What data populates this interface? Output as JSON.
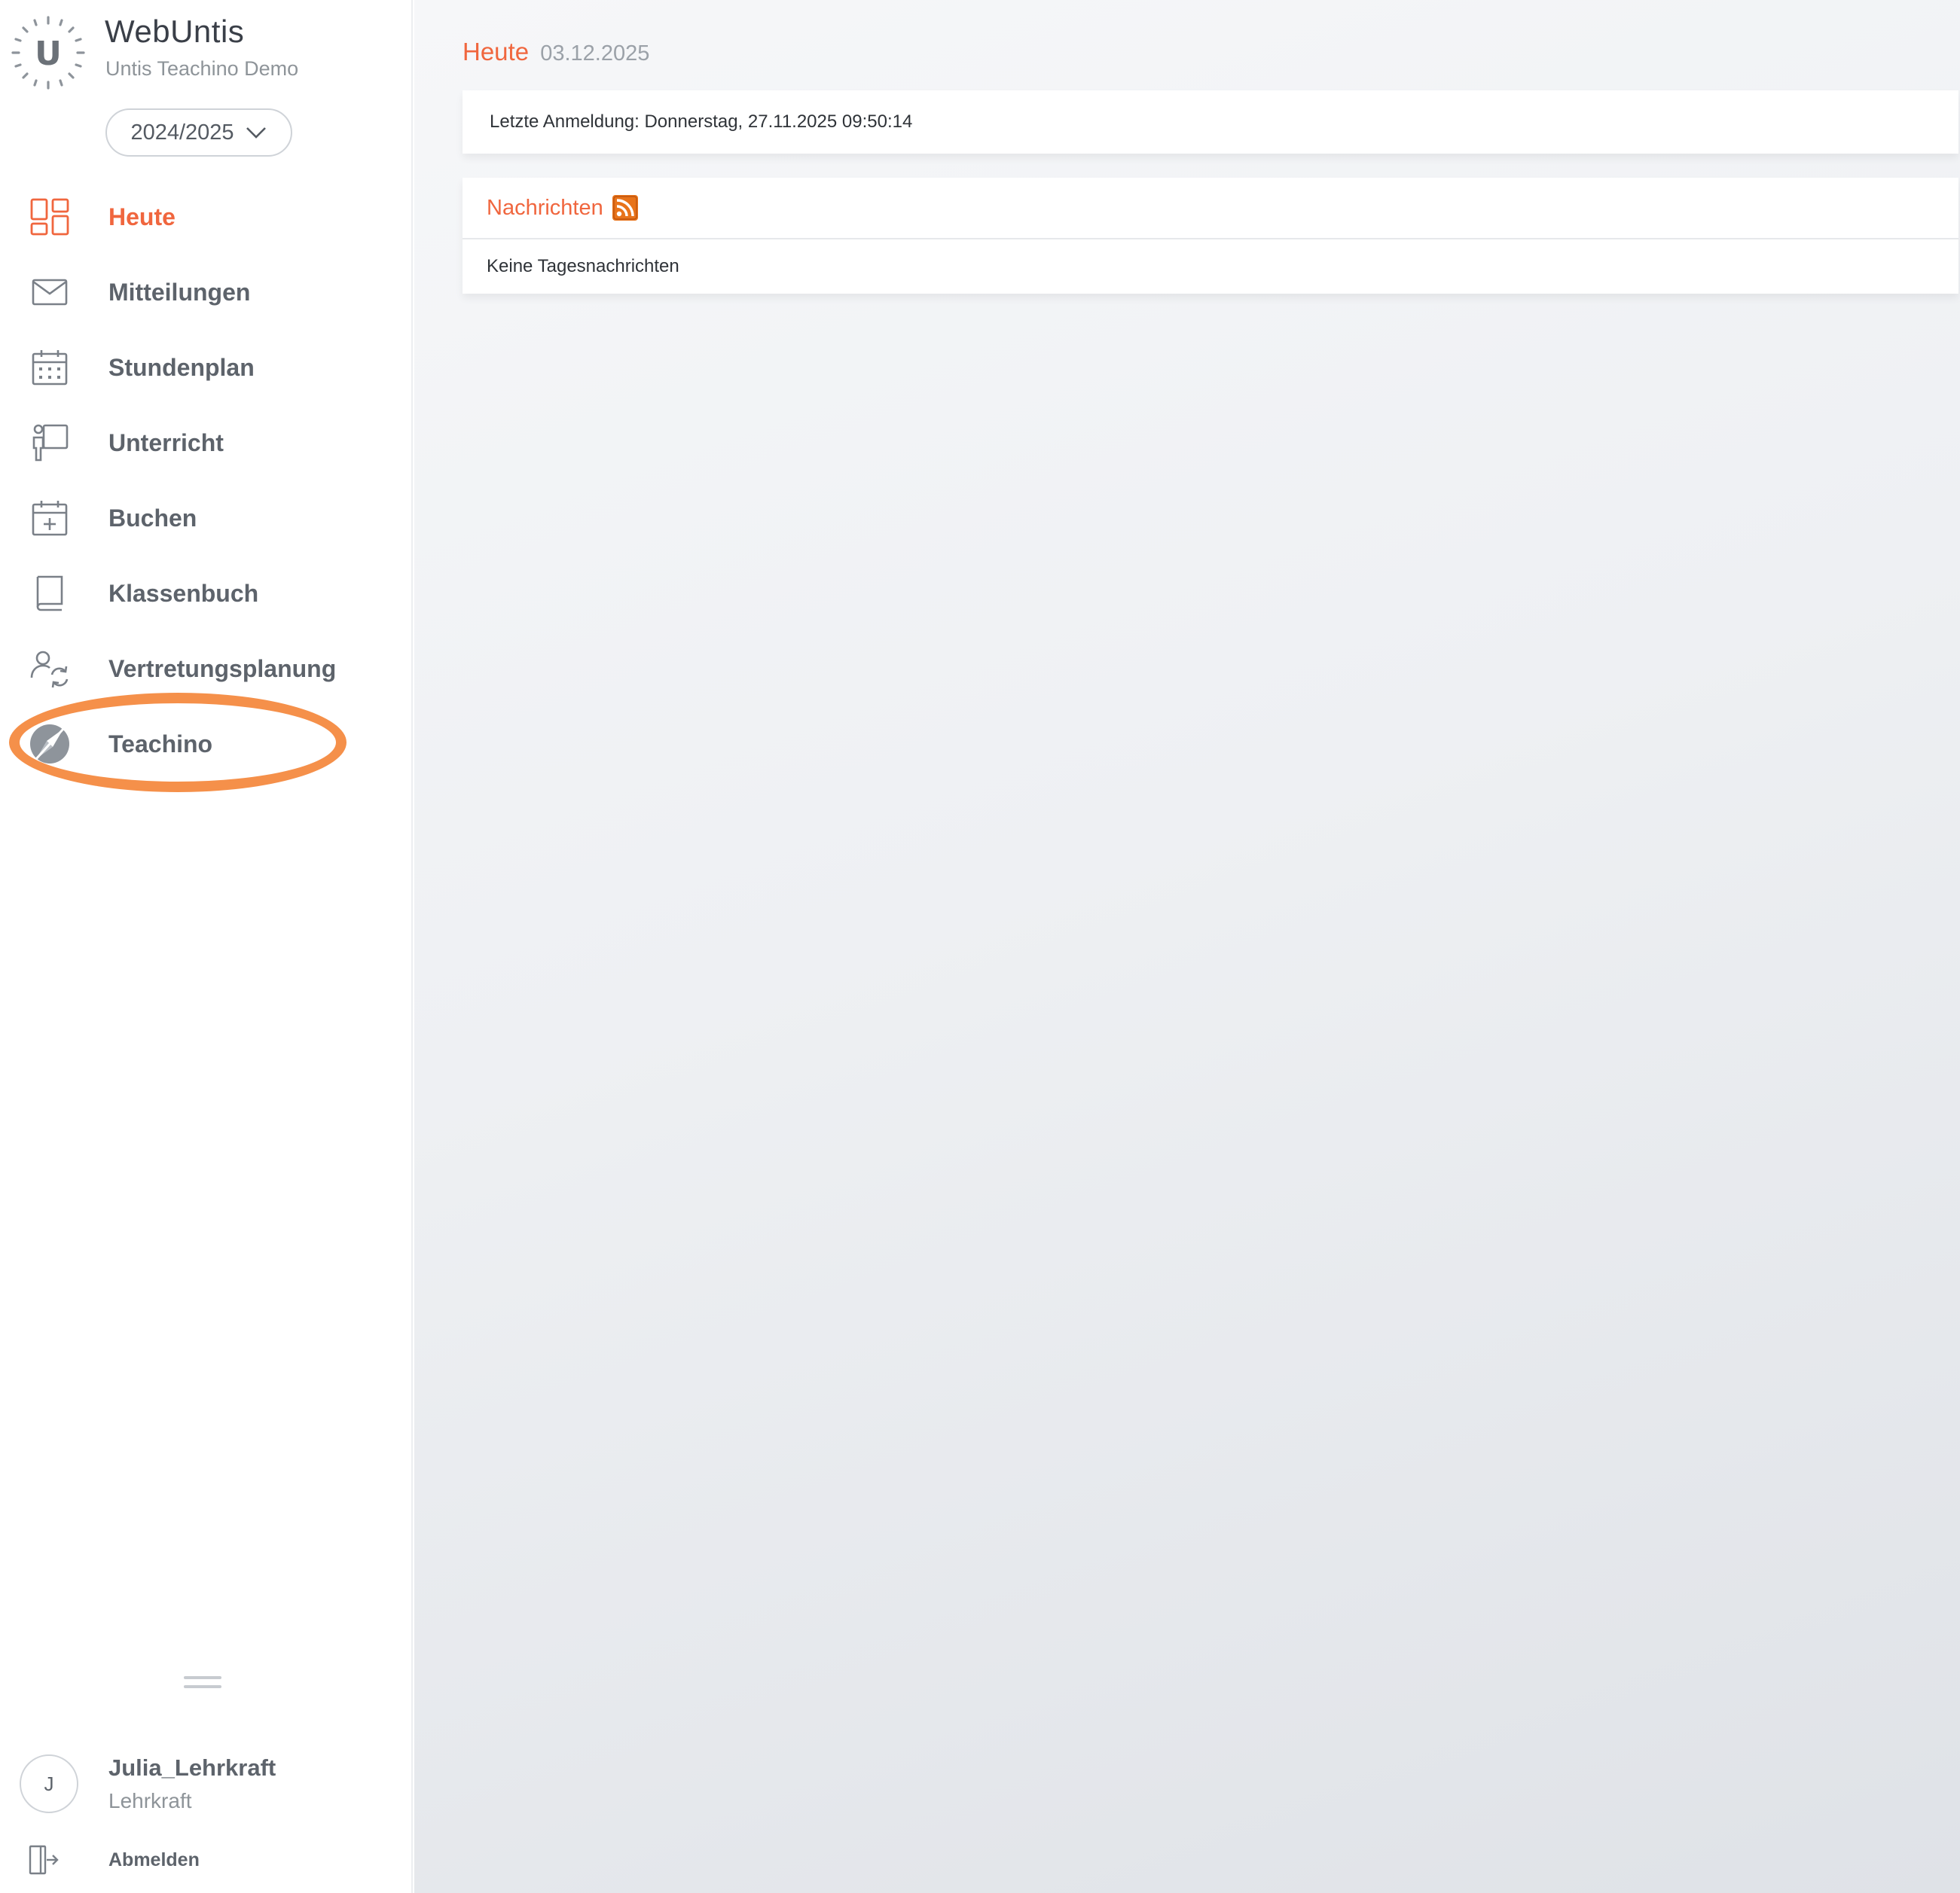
{
  "app": {
    "logo_letter": "U",
    "title": "WebUntis",
    "school": "Untis Teachino Demo",
    "school_year": "2024/2025"
  },
  "nav": [
    {
      "label": "Heute",
      "icon": "dashboard-icon",
      "active": true
    },
    {
      "label": "Mitteilungen",
      "icon": "envelope-icon"
    },
    {
      "label": "Stundenplan",
      "icon": "calendar-grid-icon"
    },
    {
      "label": "Unterricht",
      "icon": "teacher-board-icon"
    },
    {
      "label": "Buchen",
      "icon": "calendar-plus-icon"
    },
    {
      "label": "Klassenbuch",
      "icon": "book-icon"
    },
    {
      "label": "Vertretungsplanung",
      "icon": "person-swap-icon"
    },
    {
      "label": "Teachino",
      "icon": "teachino-compass-icon"
    }
  ],
  "user": {
    "initial": "J",
    "name": "Julia_Lehrkraft",
    "role": "Lehrkraft",
    "logout_label": "Abmelden"
  },
  "main": {
    "title": "Heute",
    "date": "03.12.2025",
    "last_login": "Letzte Anmeldung: Donnerstag, 27.11.2025 09:50:14",
    "news_title": "Nachrichten",
    "news_empty": "Keine Tagesnachrichten"
  },
  "colors": {
    "accent": "#f0663e",
    "highlight": "#f5904a",
    "rss": "#e8731a"
  }
}
